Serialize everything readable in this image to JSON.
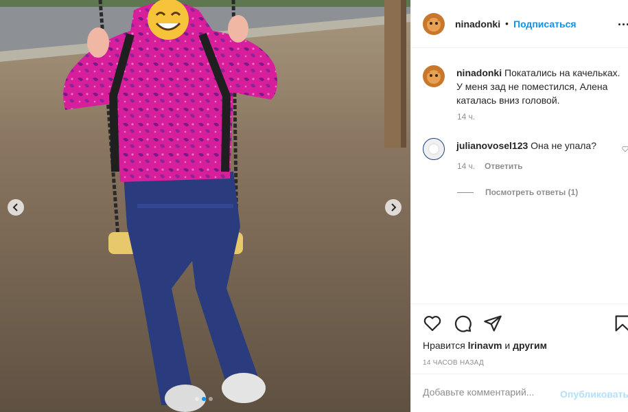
{
  "post": {
    "username": "ninadonki",
    "separator": "•",
    "follow_label": "Подписаться",
    "more_icon": "more-horizontal-icon",
    "caption": "Покатались на качельках. У меня зад не поместился, Алена каталась вниз головой.",
    "caption_time": "14 ч."
  },
  "comments": [
    {
      "username": "julianovosel123",
      "text": "Она не упала?",
      "time": "14 ч.",
      "reply_label": "Ответить",
      "view_replies": "Посмотреть ответы (1)"
    }
  ],
  "actions": {
    "like_icon": "heart-icon",
    "comment_icon": "speech-bubble-icon",
    "share_icon": "paper-plane-icon",
    "save_icon": "bookmark-icon",
    "likes_prefix": "Нравится ",
    "likes_user": "lrinavm",
    "likes_and": " и ",
    "likes_others": "другим",
    "time_ago": "14 часов назад"
  },
  "add_comment": {
    "placeholder": "Добавьте комментарий...",
    "publish_label": "Опубликовать"
  },
  "carousel": {
    "slide_count": 3,
    "active_index": 1
  },
  "colors": {
    "accent": "#0095f6",
    "publish_disabled": "#b2dffc",
    "muted": "#8e8e8e",
    "text": "#262626"
  }
}
